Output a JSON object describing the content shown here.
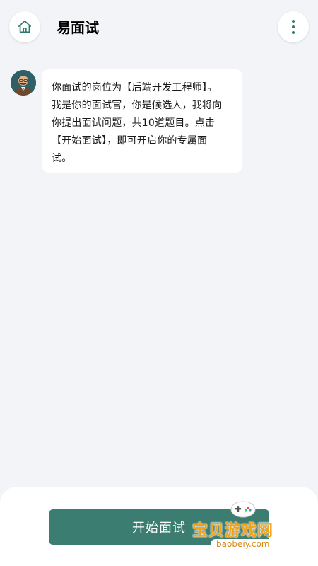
{
  "header": {
    "title": "易面试",
    "home_icon": "home-icon",
    "menu_icon": "more-vertical-icon"
  },
  "chat": {
    "messages": [
      {
        "sender": "interviewer",
        "avatar": "interviewer-avatar",
        "lines": [
          "你面试的岗位为【后端开发工程师】。",
          "我是你的面试官，你是候选人，我将向",
          "你提出面试问题，共10道题目。点击",
          "【开始面试】，即可开启你的专属面",
          "试。"
        ]
      }
    ]
  },
  "footer": {
    "start_button_label": "开始面试"
  },
  "watermark": {
    "text": "宝贝游戏网",
    "url": "baobeiy.com"
  },
  "colors": {
    "primary": "#3b7d70",
    "background": "#f3f4f8",
    "watermark": "#f2a21a"
  }
}
